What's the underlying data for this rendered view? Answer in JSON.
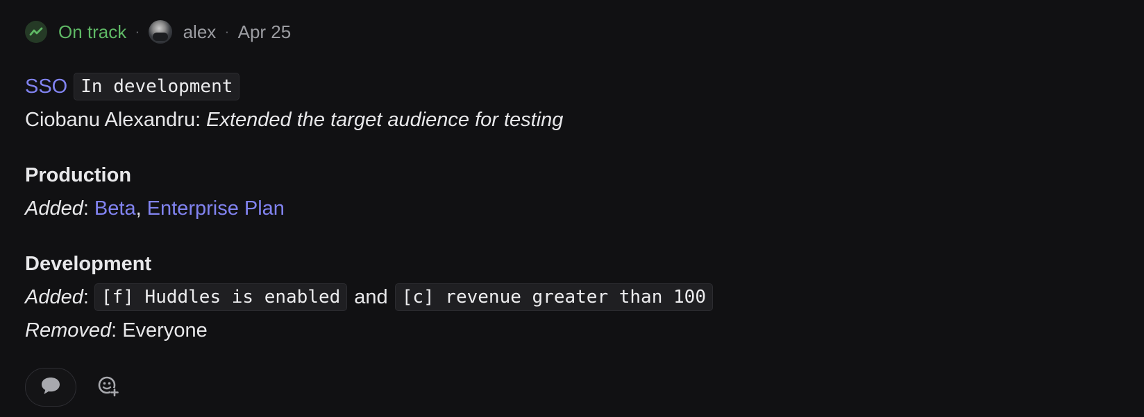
{
  "header": {
    "status_label": "On track",
    "status_icon": "trend-up-icon",
    "separator": "·",
    "author": "alex",
    "date": "Apr 25"
  },
  "update": {
    "feature_link": "SSO",
    "feature_stage": "In development",
    "author_name": "Ciobanu Alexandru:",
    "message": "Extended the target audience for testing"
  },
  "production": {
    "title": "Production",
    "added_label": "Added",
    "colon": ":",
    "items": [
      "Beta",
      "Enterprise Plan"
    ],
    "comma": ","
  },
  "development": {
    "title": "Development",
    "added_label": "Added",
    "colon": ":",
    "added_items": [
      "[f] Huddles is enabled",
      "[c] revenue greater than 100"
    ],
    "conjunction": "and",
    "removed_label": "Removed",
    "removed_value": "Everyone"
  },
  "actions": {
    "comment_icon": "speech-bubble-icon",
    "reaction_icon": "add-reaction-icon"
  },
  "colors": {
    "background": "#111113",
    "status_green": "#5fb865",
    "link_purple": "#8183f0",
    "muted_text": "#9b9ca1"
  }
}
